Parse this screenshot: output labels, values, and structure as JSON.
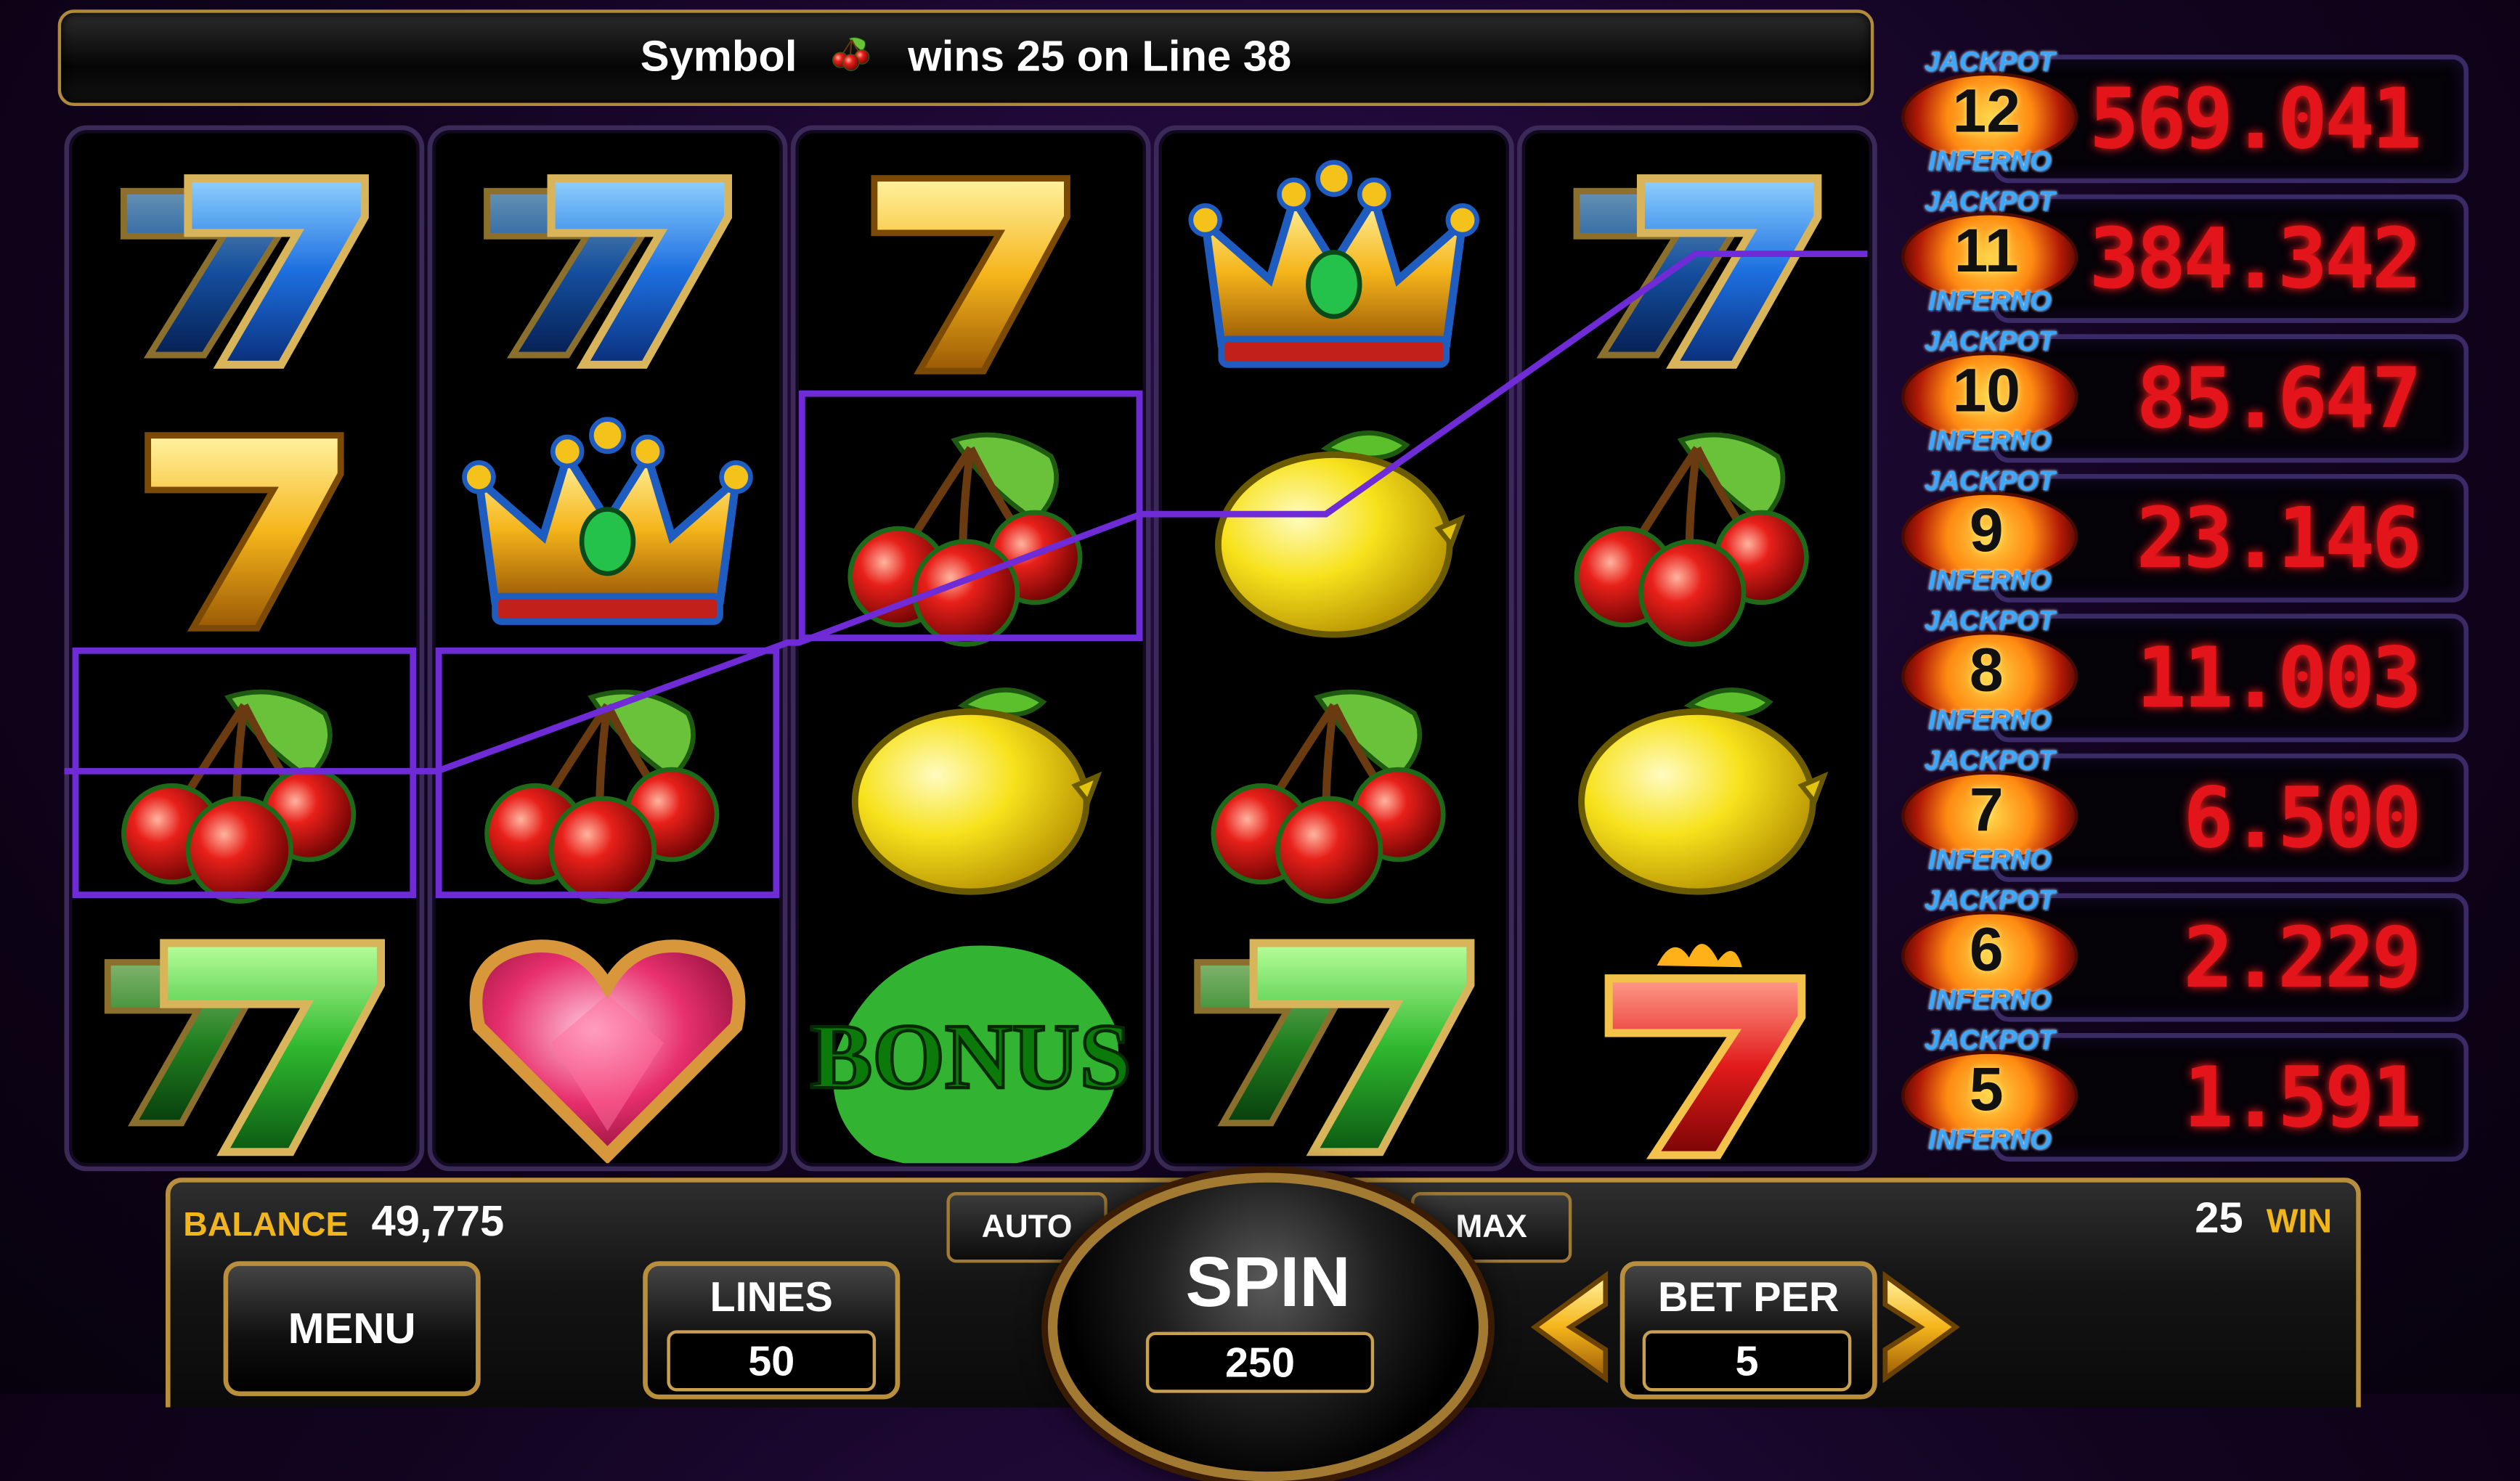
{
  "message": {
    "prefix": "Symbol",
    "suffix": "wins 25 on Line 38",
    "symbol_icon": "cherry-icon"
  },
  "reels": [
    [
      "blue-seven-icon",
      "gold-seven-icon",
      "cherry-icon",
      "green-seven-icon"
    ],
    [
      "blue-seven-icon",
      "crown-icon",
      "cherry-icon",
      "heart-gem-icon"
    ],
    [
      "gold-seven-icon",
      "cherry-icon",
      "lemon-icon",
      "bonus-icon"
    ],
    [
      "crown-icon",
      "lemon-icon",
      "cherry-icon",
      "green-seven-icon"
    ],
    [
      "blue-seven-icon",
      "cherry-icon",
      "lemon-icon",
      "red-seven-icon"
    ]
  ],
  "winning_cells": [
    [
      0,
      2
    ],
    [
      1,
      2
    ],
    [
      2,
      1
    ]
  ],
  "payline_color": "#6f2bd6",
  "bonus_label": "BONUS",
  "jackpots": [
    {
      "top": "JACKPOT",
      "level": "12",
      "bottom": "INFERNO",
      "value": "569.041"
    },
    {
      "top": "JACKPOT",
      "level": "11",
      "bottom": "INFERNO",
      "value": "384.342"
    },
    {
      "top": "JACKPOT",
      "level": "10",
      "bottom": "INFERNO",
      "value": "85.647"
    },
    {
      "top": "JACKPOT",
      "level": "9",
      "bottom": "INFERNO",
      "value": "23.146"
    },
    {
      "top": "JACKPOT",
      "level": "8",
      "bottom": "INFERNO",
      "value": "11.003"
    },
    {
      "top": "JACKPOT",
      "level": "7",
      "bottom": "INFERNO",
      "value": "6.500"
    },
    {
      "top": "JACKPOT",
      "level": "6",
      "bottom": "INFERNO",
      "value": "2.229"
    },
    {
      "top": "JACKPOT",
      "level": "5",
      "bottom": "INFERNO",
      "value": "1.591"
    }
  ],
  "controls": {
    "balance_label": "BALANCE",
    "balance_value": "49,775",
    "win_label": "WIN",
    "win_value": "25",
    "menu_label": "MENU",
    "lines_label": "LINES",
    "lines_value": "50",
    "auto_label": "AUTO",
    "max_label": "MAX",
    "spin_label": "SPIN",
    "spin_value": "250",
    "bet_per_label": "BET PER",
    "bet_per_value": "5"
  },
  "colors": {
    "gold": "#f2b51a",
    "jackpot_red": "#e3141a",
    "highlight": "#6f2bd6"
  }
}
